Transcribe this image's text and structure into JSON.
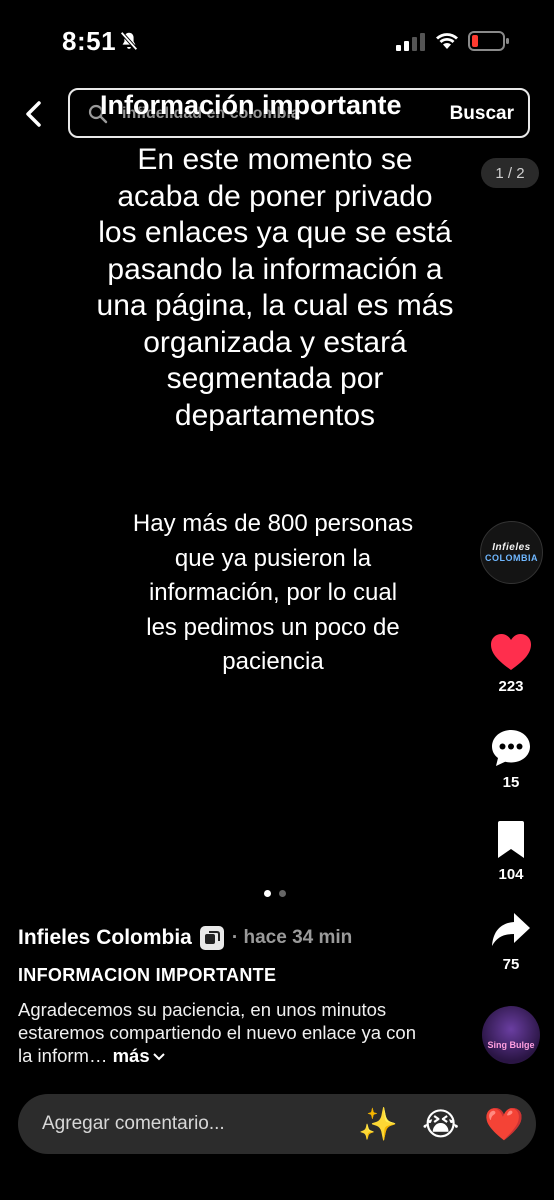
{
  "status_bar": {
    "time": "8:51"
  },
  "header": {
    "search_placeholder": "infidelidad en colombia",
    "overlay_title": "Información importante",
    "search_button": "Buscar"
  },
  "carousel": {
    "indicator": "1 / 2"
  },
  "content": {
    "main_lines": [
      "En este momento se",
      "acaba de poner privado",
      "los enlaces ya que se está",
      "pasando la información a",
      "una página, la cual es más",
      "organizada y estará",
      "segmentada por",
      "departamentos"
    ],
    "sub_lines": [
      "Hay más de 800 personas",
      "que ya pusieron la",
      "información, por lo cual",
      "les pedimos un poco de",
      "paciencia"
    ]
  },
  "avatar": {
    "line1": "Infieles",
    "line2": "COLOMBIA"
  },
  "actions": {
    "likes": "223",
    "comments": "15",
    "saves": "104",
    "shares": "75"
  },
  "music": {
    "disc_text": "Sing Bulge"
  },
  "post": {
    "author": "Infieles Colombia",
    "time": "· hace 34 min",
    "title": "INFORMACION IMPORTANTE",
    "description": "Agradecemos su paciencia, en unos minutos estaremos compartiendo el nuevo enlace ya con la inform…",
    "more": "más"
  },
  "comment_bar": {
    "placeholder": "Agregar comentario...",
    "emojis": [
      "✨",
      "😭",
      "❤️"
    ]
  },
  "colors": {
    "like": "#ff2e4d",
    "background": "#000000",
    "accent_blue": "#6fb7ff"
  },
  "icons": [
    "mute-icon",
    "signal-icon",
    "wifi-icon",
    "battery-icon",
    "back-icon",
    "search-icon",
    "heart-icon",
    "comment-icon",
    "bookmark-icon",
    "share-icon"
  ]
}
